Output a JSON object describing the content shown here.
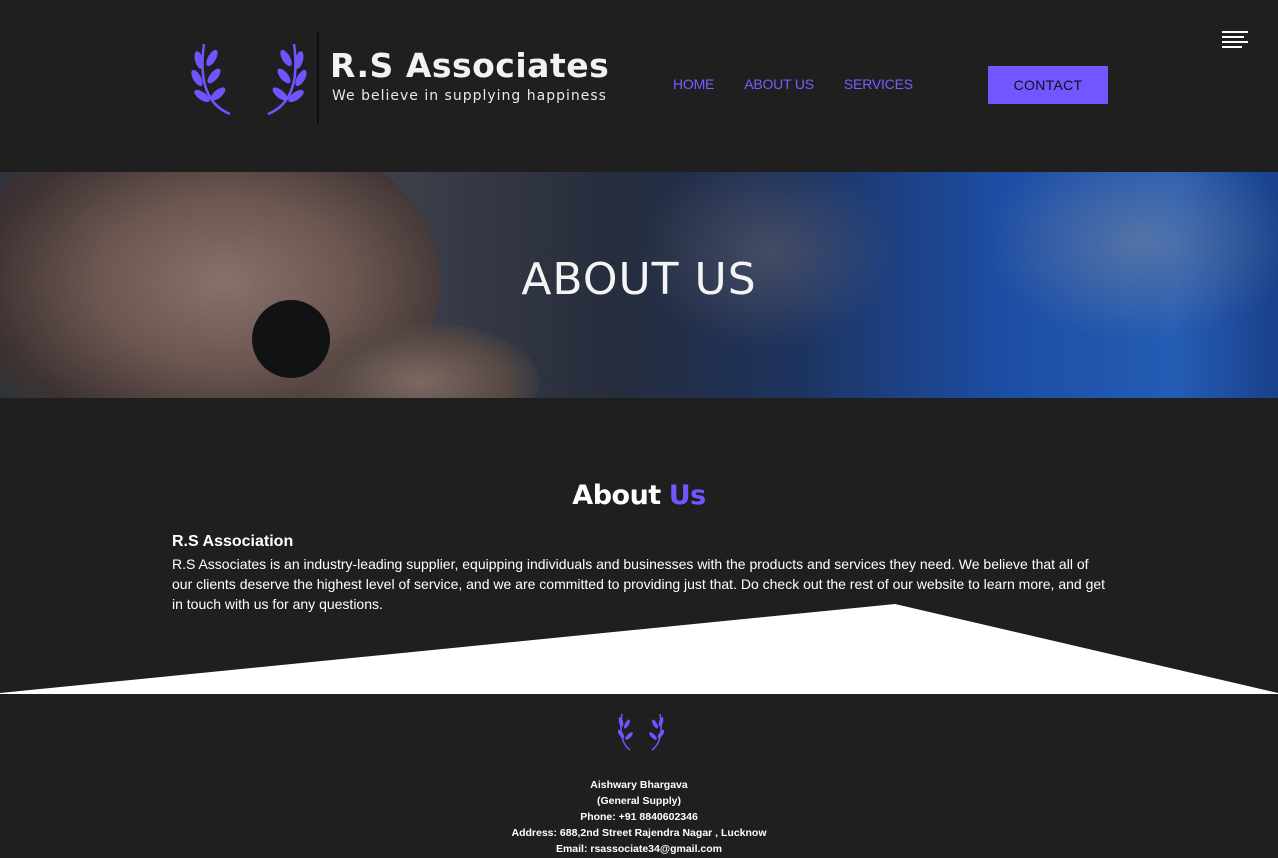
{
  "header": {
    "brand": "R.S Associates",
    "tagline": "We believe in supplying happiness",
    "nav": [
      "HOME",
      "ABOUT US",
      "SERVICES"
    ],
    "contact_label": "CONTACT",
    "menu_icon": "hamburger-icon"
  },
  "hero": {
    "title": "ABOUT US"
  },
  "about": {
    "title_part1": "About",
    "title_part2": "Us",
    "subtitle": "R.S Association",
    "body": "R.S Associates is an industry-leading supplier, equipping individuals and businesses with the products and services they need. We believe that all of our clients deserve the highest level of service, and we are committed to providing just that. Do check out the rest of our website to learn more, and get in touch with us for any questions."
  },
  "footer": {
    "name": "Aishwary Bhargava",
    "role": "(General Supply)",
    "phone": "Phone: +91 8840602346",
    "address": "Address: 688,2nd Street Rajendra Nagar , Lucknow",
    "email": "Email: rsassociate34@gmail.com"
  },
  "colors": {
    "accent": "#7157ff",
    "background": "#1f1f20",
    "text": "#ffffff"
  }
}
